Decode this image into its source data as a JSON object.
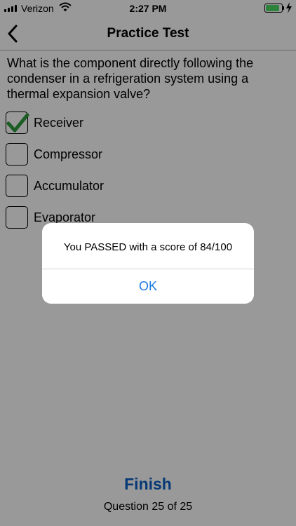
{
  "status_bar": {
    "carrier": "Verizon",
    "time": "2:27 PM",
    "battery_level": 0.85,
    "icons": [
      "signal-icon",
      "wifi-icon",
      "battery-icon",
      "charging-bolt-icon"
    ]
  },
  "nav": {
    "title": "Practice Test",
    "back_icon": "chevron-left-icon"
  },
  "question": {
    "text": "What is the component directly following the condenser in a refrigeration system using a thermal expansion valve?",
    "answers": [
      {
        "label": "Receiver",
        "checked": true
      },
      {
        "label": "Compressor",
        "checked": false
      },
      {
        "label": "Accumulator",
        "checked": false
      },
      {
        "label": "Evaporator",
        "checked": false
      }
    ]
  },
  "footer": {
    "finish_label": "Finish",
    "progress": "Question 25 of 25"
  },
  "alert": {
    "message": "You PASSED with a score of 84/100",
    "ok_label": "OK"
  },
  "colors": {
    "accent_blue": "#0b60c3",
    "ok_blue": "#1b7be3",
    "check_green": "#2e9b3a",
    "battery_green": "#4cd964"
  }
}
